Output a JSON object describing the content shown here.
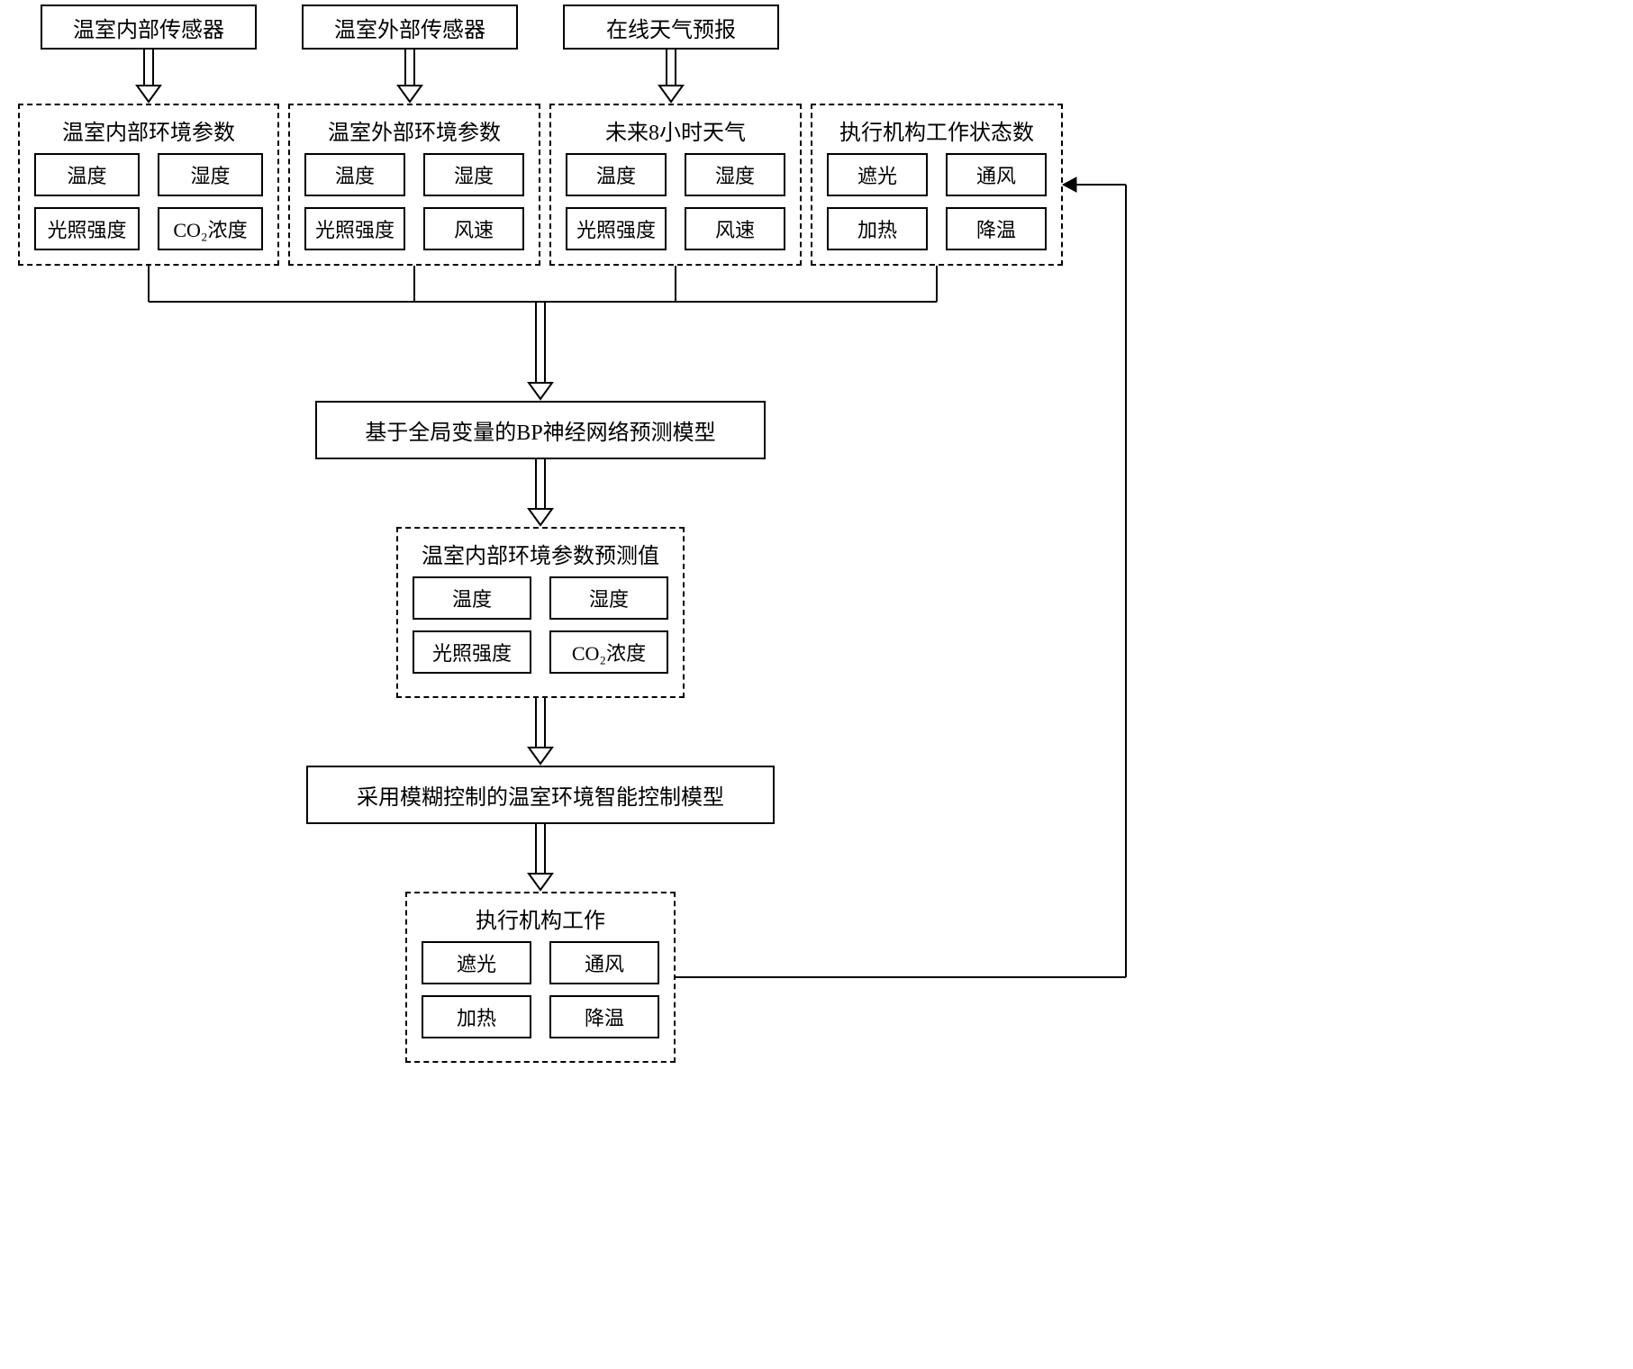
{
  "top_sources": {
    "internal_sensor": "温室内部传感器",
    "external_sensor": "温室外部传感器",
    "online_forecast": "在线天气预报"
  },
  "group_internal": {
    "title": "温室内部环境参数",
    "items": [
      "温度",
      "湿度",
      "光照强度",
      "CO₂浓度"
    ]
  },
  "group_external": {
    "title": "温室外部环境参数",
    "items": [
      "温度",
      "湿度",
      "光照强度",
      "风速"
    ]
  },
  "group_forecast": {
    "title": "未来8小时天气",
    "items": [
      "温度",
      "湿度",
      "光照强度",
      "风速"
    ]
  },
  "group_actuator_state": {
    "title": "执行机构工作状态数",
    "items": [
      "遮光",
      "通风",
      "加热",
      "降温"
    ]
  },
  "bp_model": "基于全局变量的BP神经网络预测模型",
  "group_predicted": {
    "title": "温室内部环境参数预测值",
    "items": [
      "温度",
      "湿度",
      "光照强度",
      "CO₂浓度"
    ]
  },
  "fuzzy_model": "采用模糊控制的温室环境智能控制模型",
  "group_actuator_work": {
    "title": "执行机构工作",
    "items": [
      "遮光",
      "通风",
      "加热",
      "降温"
    ]
  }
}
